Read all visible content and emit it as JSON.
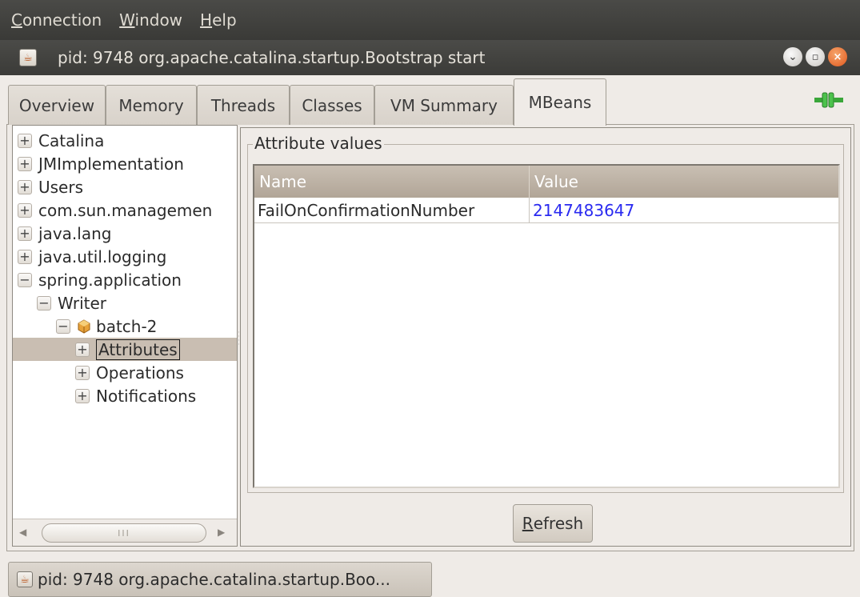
{
  "menubar": {
    "items": [
      {
        "label": "Connection",
        "mnemonic": "C",
        "rest": "onnection"
      },
      {
        "label": "Window",
        "mnemonic": "W",
        "rest": "indow"
      },
      {
        "label": "Help",
        "mnemonic": "H",
        "rest": "elp"
      }
    ]
  },
  "window": {
    "title": "pid: 9748 org.apache.catalina.startup.Bootstrap start",
    "buttons": [
      "minimize-icon",
      "maximize-icon",
      "close-icon"
    ]
  },
  "tabs": [
    {
      "label": "Overview",
      "active": false
    },
    {
      "label": "Memory",
      "active": false
    },
    {
      "label": "Threads",
      "active": false
    },
    {
      "label": "Classes",
      "active": false
    },
    {
      "label": "VM Summary",
      "active": false
    },
    {
      "label": "MBeans",
      "active": true
    }
  ],
  "tree": {
    "nodes": [
      {
        "label": "Catalina",
        "expander": "+"
      },
      {
        "label": "JMImplementation",
        "expander": "+"
      },
      {
        "label": "Users",
        "expander": "+"
      },
      {
        "label": "com.sun.managemen",
        "expander": "+"
      },
      {
        "label": "java.lang",
        "expander": "+"
      },
      {
        "label": "java.util.logging",
        "expander": "+"
      },
      {
        "label": "spring.application",
        "expander": "−"
      },
      {
        "label": "Writer",
        "expander": "−"
      },
      {
        "label": "batch-2",
        "expander": "−",
        "icon": "bean-icon"
      },
      {
        "label": "Attributes",
        "expander": "+",
        "selected": true
      },
      {
        "label": "Operations",
        "expander": "+"
      },
      {
        "label": "Notifications",
        "expander": "+"
      }
    ]
  },
  "attributes": {
    "group_title": "Attribute values",
    "columns": [
      "Name",
      "Value"
    ],
    "rows": [
      {
        "name": "FailOnConfirmationNumber",
        "value": "2147483647"
      }
    ]
  },
  "refresh_button": {
    "mnemonic": "R",
    "rest": "efresh"
  },
  "taskbar": {
    "label": "pid: 9748 org.apache.catalina.startup.Boo..."
  },
  "colors": {
    "menubar_bg": "#3f3f3c",
    "selection": "#c9beb2",
    "value_text": "#2a2af0",
    "close_button": "#e0581d"
  }
}
